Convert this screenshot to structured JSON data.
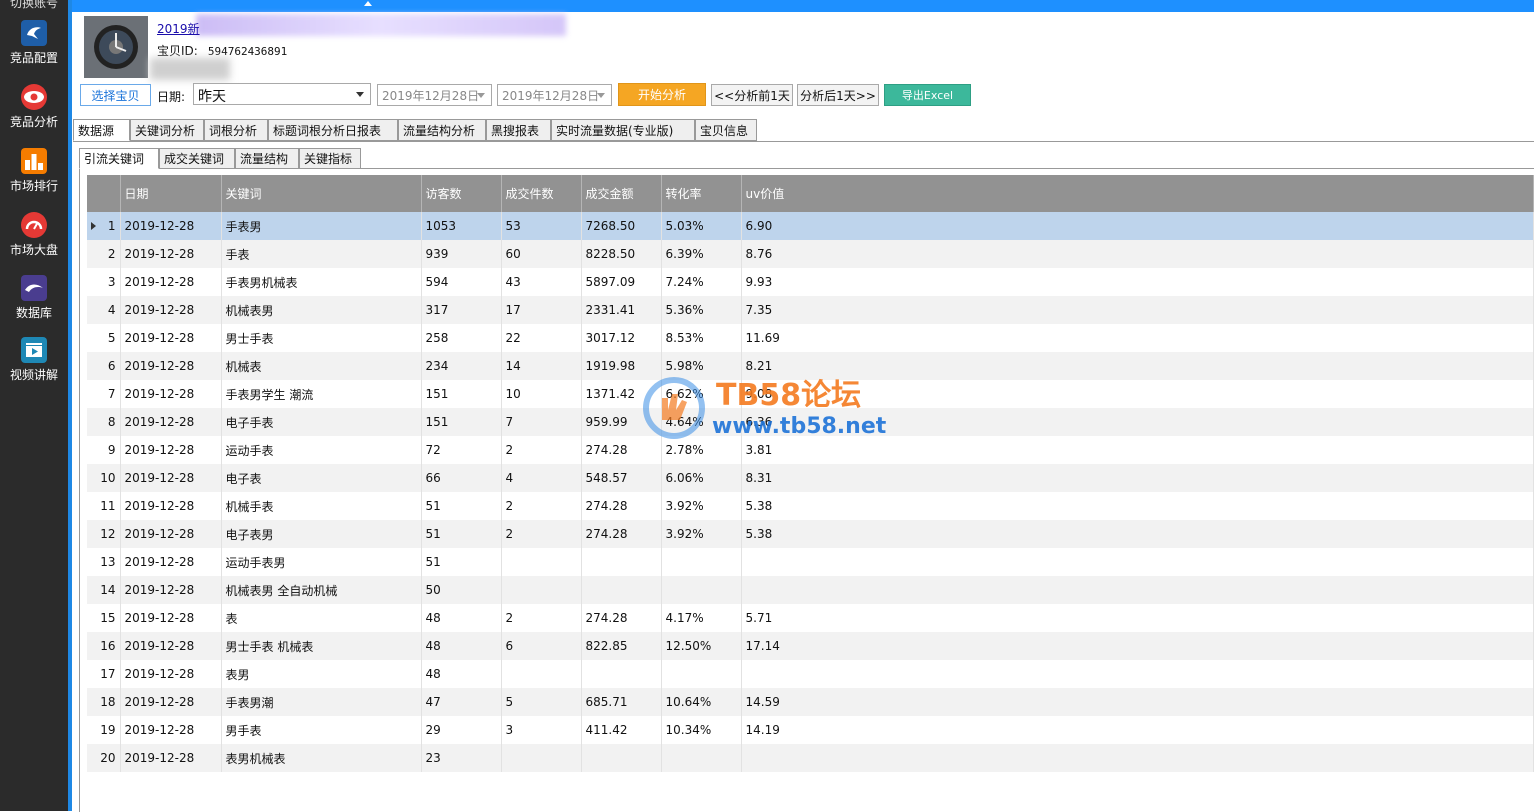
{
  "sidebar": {
    "cut_label": "切换账号",
    "items": [
      {
        "label": "竞品配置",
        "icon": "eagle-icon",
        "color": "#1e5ea8"
      },
      {
        "label": "竞品分析",
        "icon": "eye-icon",
        "color": "#e53935"
      },
      {
        "label": "市场排行",
        "icon": "ranking-icon",
        "color": "#f57c00"
      },
      {
        "label": "市场大盘",
        "icon": "gauge-icon",
        "color": "#e53935"
      },
      {
        "label": "数据库",
        "icon": "database-icon",
        "color": "#4a3d8f"
      },
      {
        "label": "视频讲解",
        "icon": "video-icon",
        "color": "#1e88b5"
      }
    ]
  },
  "product": {
    "title": "2019新",
    "id_label": "宝贝ID:",
    "id_value": "594762436891"
  },
  "toolbar": {
    "select_label": "选择宝贝",
    "date_label": "日期:",
    "date_mode": "昨天",
    "start_date": "2019年12月28日",
    "end_date": "2019年12月28日",
    "start_label": "开始分析",
    "prev_label": "<<分析前1天",
    "next_label": "分析后1天>>",
    "excel_label": "导出Excel"
  },
  "tabs": [
    "数据源",
    "关键词分析",
    "词根分析",
    "标题词根分析日报表",
    "流量结构分析",
    "黑搜报表",
    "实时流量数据(专业版)",
    "宝贝信息"
  ],
  "subtabs": [
    "引流关键词",
    "成交关键词",
    "流量结构",
    "关键指标"
  ],
  "table": {
    "columns": [
      "日期",
      "关键词",
      "访客数",
      "成交件数",
      "成交金额",
      "转化率",
      "uv价值"
    ],
    "rows": [
      [
        "1",
        "2019-12-28",
        "手表男",
        "1053",
        "53",
        "7268.50",
        "5.03%",
        "6.90"
      ],
      [
        "2",
        "2019-12-28",
        "手表",
        "939",
        "60",
        "8228.50",
        "6.39%",
        "8.76"
      ],
      [
        "3",
        "2019-12-28",
        "手表男机械表",
        "594",
        "43",
        "5897.09",
        "7.24%",
        "9.93"
      ],
      [
        "4",
        "2019-12-28",
        "机械表男",
        "317",
        "17",
        "2331.41",
        "5.36%",
        "7.35"
      ],
      [
        "5",
        "2019-12-28",
        "男士手表",
        "258",
        "22",
        "3017.12",
        "8.53%",
        "11.69"
      ],
      [
        "6",
        "2019-12-28",
        "机械表",
        "234",
        "14",
        "1919.98",
        "5.98%",
        "8.21"
      ],
      [
        "7",
        "2019-12-28",
        "手表男学生 潮流",
        "151",
        "10",
        "1371.42",
        "6.62%",
        "9.08"
      ],
      [
        "8",
        "2019-12-28",
        "电子手表",
        "151",
        "7",
        "959.99",
        "4.64%",
        "6.36"
      ],
      [
        "9",
        "2019-12-28",
        "运动手表",
        "72",
        "2",
        "274.28",
        "2.78%",
        "3.81"
      ],
      [
        "10",
        "2019-12-28",
        "电子表",
        "66",
        "4",
        "548.57",
        "6.06%",
        "8.31"
      ],
      [
        "11",
        "2019-12-28",
        "机械手表",
        "51",
        "2",
        "274.28",
        "3.92%",
        "5.38"
      ],
      [
        "12",
        "2019-12-28",
        "电子表男",
        "51",
        "2",
        "274.28",
        "3.92%",
        "5.38"
      ],
      [
        "13",
        "2019-12-28",
        "运动手表男",
        "51",
        "",
        "",
        "",
        ""
      ],
      [
        "14",
        "2019-12-28",
        "机械表男 全自动机械",
        "50",
        "",
        "",
        "",
        ""
      ],
      [
        "15",
        "2019-12-28",
        "表",
        "48",
        "2",
        "274.28",
        "4.17%",
        "5.71"
      ],
      [
        "16",
        "2019-12-28",
        "男士手表 机械表",
        "48",
        "6",
        "822.85",
        "12.50%",
        "17.14"
      ],
      [
        "17",
        "2019-12-28",
        "表男",
        "48",
        "",
        "",
        "",
        ""
      ],
      [
        "18",
        "2019-12-28",
        "手表男潮",
        "47",
        "5",
        "685.71",
        "10.64%",
        "14.59"
      ],
      [
        "19",
        "2019-12-28",
        "男手表",
        "29",
        "3",
        "411.42",
        "10.34%",
        "14.19"
      ],
      [
        "20",
        "2019-12-28",
        "表男机械表",
        "23",
        "",
        "",
        "",
        ""
      ]
    ]
  },
  "watermark": {
    "line1": "TB58论坛",
    "line2": "www.tb58.net"
  }
}
